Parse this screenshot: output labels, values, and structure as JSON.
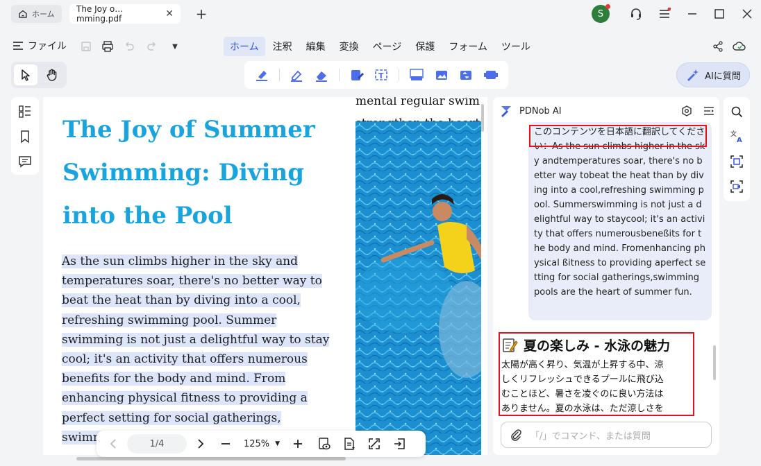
{
  "titlebar": {
    "home_tab": "ホーム",
    "doc_tab": "The Joy o…mming.pdf",
    "avatar_letter": "S"
  },
  "menubar": {
    "file": "ファイル",
    "menus": [
      "ホーム",
      "注釈",
      "編集",
      "変換",
      "ページ",
      "保護",
      "フォーム",
      "ツール"
    ],
    "active_menu": "ホーム"
  },
  "toolbar": {
    "ask_ai": "AIに質問"
  },
  "document": {
    "title": "The Joy of Summer Swimming: Diving into the Pool",
    "body_lines": [
      "As the sun climbs higher in the sky and",
      "temperatures soar, there's no better way to",
      "beat the heat than by diving into a cool,",
      "refreshing swimming pool. Summer",
      "swimming is not just a delightful way to stay",
      "cool; it's an activity that offers numerous",
      "benefits for the body and mind. From",
      "enhancing physical fitness to providing a",
      "perfect setting for social gatherings,",
      "swimming"
    ],
    "right_col_lines": [
      "mental regular swim",
      "strengthen the heart,"
    ]
  },
  "pagenav": {
    "page": "1/4",
    "zoom": "125%"
  },
  "ai_panel": {
    "title": "PDNob AI",
    "prompt_first_line": "このコンテンツを日本語に翻訳してく",
    "prompt_rest": "ださい：As the sun climbs higher in the sky andtemperatures soar, there's no better way tobeat the heat than by diving into a cool,refreshing swimming pool. Summerswimming is not just a delightful way to staycool; it's an activity that offers numerousbeneßits for the body and mind. Fromenhancing physical ßitness to providing aperfect setting for social gatherings,swimming pools are the heart of summer fun.",
    "answer_title": "夏の楽しみ - 水泳の魅力",
    "answer_lines": [
      "太陽が高く昇り、気温が上昇する中、涼",
      "しくリフレッシュできるプールに飛び込",
      "むことほど、暑さを凌ぐのに良い方法は",
      "ありません。夏の水泳は、ただ涼しさを"
    ],
    "input_placeholder": "「/」でコマンド、または質問"
  },
  "colors": {
    "accent": "#3556d8",
    "title_blue": "#1aa4de",
    "highlight": "#dde5fb",
    "red_box": "#e0121a",
    "pool": "#1b8fd0"
  }
}
